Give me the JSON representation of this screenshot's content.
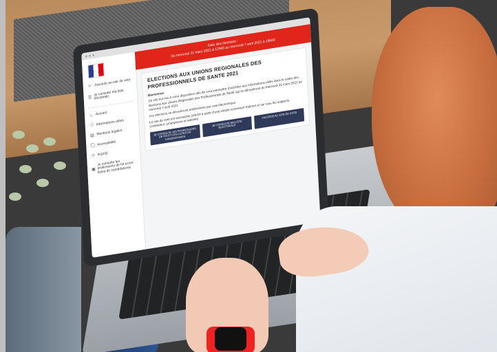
{
  "banner": {
    "line1": "Date des élections :",
    "line2": "Du mercredi 31 mars 2021 à 12h00 au mercredi 7 avril 2021 à 18h00"
  },
  "sidebar": {
    "items": [
      {
        "label": "J'accède au site de vote",
        "icon": "user-icon"
      },
      {
        "label": "Je consulte ma liste électorale",
        "icon": "list-icon"
      },
      {
        "label": "Accueil",
        "icon": "home-icon"
      },
      {
        "label": "Informations utiles",
        "icon": "info-icon"
      },
      {
        "label": "Mentions légales",
        "icon": "document-icon"
      },
      {
        "label": "Accessibilité",
        "icon": "accessibility-icon"
      },
      {
        "label": "RGPD",
        "icon": "shield-icon"
      },
      {
        "label": "Je consulte les professions de foi et les listes de candidatures",
        "icon": "folder-icon"
      }
    ]
  },
  "main": {
    "title": "ELECTIONS AUX UNIONS REGIONALES DES PROFESSIONNELS DE SANTE 2021",
    "greeting": "Bienvenue",
    "paragraph1": "Ce site est mis à votre disposition afin de vous permettre d'accéder aux informations utiles dans le cadre des élections aux Unions Régionales des Professionnels de Santé qui se dérouleront du mercredi 31 mars 2021 au mercredi 7 avril 2021.",
    "paragraph2": "Les élections se dérouleront entièrement par voie électronique.",
    "paragraph3": "Le site de vote est accessible 24h/24 à partir d'une simple connexion Internet et sur tous les supports (ordinateur, smartphone et tablette).",
    "buttons": [
      "JE CONSULTE LES PROFESSIONS DE FOI ET LES LISTES DE CANDIDATURES",
      "JE CONSULTE MA LISTE ÉLECTORALE",
      "J'ACCÈDE AU SITE DE VOTE"
    ]
  },
  "colors": {
    "banner": "#e0251b",
    "button": "#2f3a5a"
  }
}
